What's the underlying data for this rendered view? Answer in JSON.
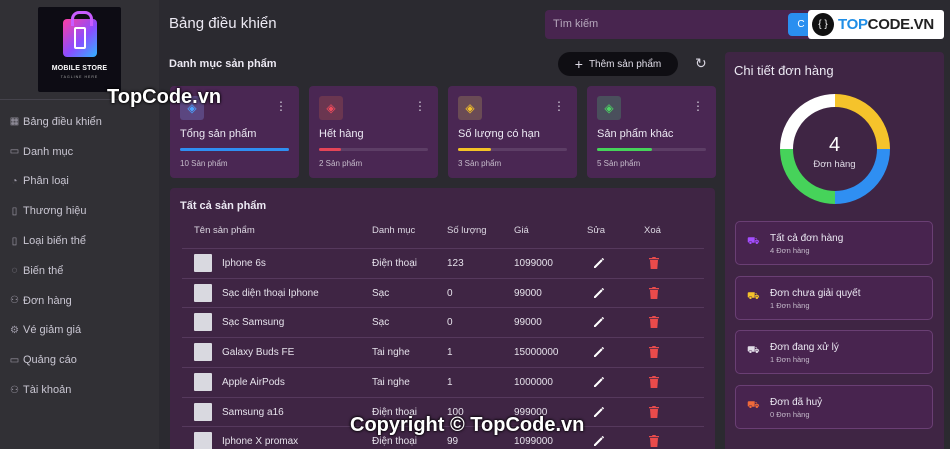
{
  "logo": {
    "brand": "MOBILE STORE",
    "tagline": "TAGLINE HERE"
  },
  "sidebar": {
    "items": [
      {
        "label": "Bảng điều khiển",
        "icon": "grid-icon"
      },
      {
        "label": "Danh mục",
        "icon": "folder-icon"
      },
      {
        "label": "Phân loại",
        "icon": "chart-icon"
      },
      {
        "label": "Thương hiệu",
        "icon": "document-icon"
      },
      {
        "label": "Loại biến thể",
        "icon": "document-icon"
      },
      {
        "label": "Biến thể",
        "icon": "chat-icon"
      },
      {
        "label": "Đơn hàng",
        "icon": "user-icon"
      },
      {
        "label": "Vé giảm giá",
        "icon": "gear-icon"
      },
      {
        "label": "Quảng cáo",
        "icon": "folder-icon"
      },
      {
        "label": "Tài khoản",
        "icon": "user-icon"
      }
    ]
  },
  "header": {
    "title": "Bảng điều khiển",
    "search_placeholder": "Tìm kiếm",
    "search_button": "C"
  },
  "banner": {
    "prefix": "TOP",
    "suffix": "CODE.VN"
  },
  "categories": {
    "title": "Danh mục sản phẩm",
    "add_button": "Thêm sản phẩm",
    "cards": [
      {
        "label": "Tổng sản phẩm",
        "count": "10 Sản phẩm",
        "progress": 1.0,
        "color": "#2f8ff2",
        "icon_bg": "#5b4680",
        "icon_color": "#4da3ff"
      },
      {
        "label": "Hết hàng",
        "count": "2 Sản phẩm",
        "progress": 0.2,
        "color": "#e54557",
        "icon_bg": "#6a3650",
        "icon_color": "#f14c5d"
      },
      {
        "label": "Số lượng có hạn",
        "count": "3 Sản phẩm",
        "progress": 0.3,
        "color": "#f4c326",
        "icon_bg": "#6a4b55",
        "icon_color": "#f5c22a"
      },
      {
        "label": "Sản phẩm khác",
        "count": "5 Sản phẩm",
        "progress": 0.5,
        "color": "#46d35a",
        "icon_bg": "#4a4f5c",
        "icon_color": "#4dd664"
      }
    ]
  },
  "products": {
    "title": "Tất cả sản phẩm",
    "columns": [
      "Tên sản phẩm",
      "Danh mục",
      "Số lượng",
      "Giá",
      "Sửa",
      "Xoá"
    ],
    "rows": [
      {
        "name": "Iphone 6s",
        "category": "Điện thoại",
        "qty": "123",
        "price": "1099000"
      },
      {
        "name": "Sạc diện thoại Iphone",
        "category": "Sạc",
        "qty": "0",
        "price": "99000"
      },
      {
        "name": "Sạc Samsung",
        "category": "Sạc",
        "qty": "0",
        "price": "99000"
      },
      {
        "name": "Galaxy Buds FE",
        "category": "Tai nghe",
        "qty": "1",
        "price": "15000000"
      },
      {
        "name": "Apple AirPods",
        "category": "Tai nghe",
        "qty": "1",
        "price": "1000000"
      },
      {
        "name": "Samsung a16",
        "category": "Điện thoại",
        "qty": "100",
        "price": "999000"
      },
      {
        "name": "Iphone X promax",
        "category": "Điện thoại",
        "qty": "99",
        "price": "1099000"
      }
    ]
  },
  "orders": {
    "title": "Chi tiết đơn hàng",
    "total": "4",
    "total_label": "Đơn hàng",
    "donut_segments": [
      {
        "value": 1,
        "color": "#f5c32b"
      },
      {
        "value": 1,
        "color": "#2f8ff2"
      },
      {
        "value": 1,
        "color": "#46d35a"
      },
      {
        "value": 1,
        "color": "#ffffff"
      }
    ],
    "stats": [
      {
        "label": "Tất cả đơn hàng",
        "count": "4 Đơn hàng",
        "color": "#a44dff"
      },
      {
        "label": "Đơn chưa giải quyết",
        "count": "1 Đơn hàng",
        "color": "#f5c32b"
      },
      {
        "label": "Đơn đang xử lý",
        "count": "1 Đơn hàng",
        "color": "#e0dbe6"
      },
      {
        "label": "Đơn đã huỷ",
        "count": "0 Đơn hàng",
        "color": "#f06a3a"
      }
    ]
  },
  "watermarks": {
    "top": "TopCode.vn",
    "bottom": "Copyright © TopCode.vn"
  }
}
